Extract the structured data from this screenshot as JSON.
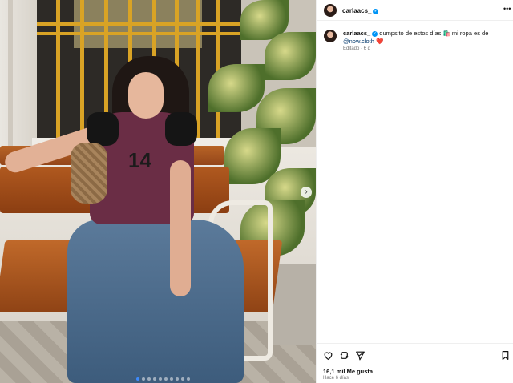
{
  "post": {
    "username": "carlaacs_",
    "caption_text": "dumpsito de estos días 🛍️ mi ropa es de",
    "caption_mention": "@now.cloth",
    "caption_emoji": "❤️",
    "edited_label": "Editado · 6 d",
    "likes": "16,1 mil Me gusta",
    "timestamp": "Hace 6 días",
    "shirt_number": "14"
  },
  "carousel": {
    "slides": 10,
    "active_slide": 1
  },
  "icons": {
    "more": "more-options-icon",
    "like": "heart-icon",
    "comment": "comment-icon",
    "share": "share-icon",
    "save": "bookmark-icon",
    "next": "chevron-right-icon",
    "verified": "verified-badge-icon"
  },
  "colors": {
    "verified": "#0095f6",
    "mention": "#00376b",
    "carousel_active": "#3d8bfd",
    "heart": "#ed4956"
  }
}
